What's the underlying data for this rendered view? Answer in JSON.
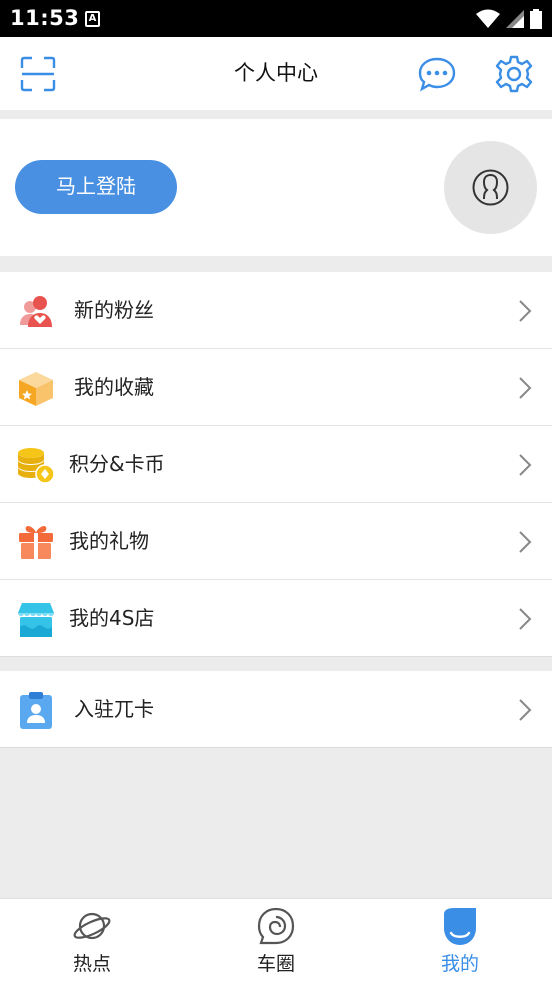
{
  "status_bar": {
    "time": "11:53",
    "notification_letter": "A"
  },
  "header": {
    "title": "个人中心",
    "scan_icon": "scan-icon",
    "message_icon": "message-icon",
    "settings_icon": "gear-icon"
  },
  "profile": {
    "login_label": "马上登陆",
    "avatar_icon": "user-avatar-icon"
  },
  "menu_group_1": [
    {
      "label": "新的粉丝",
      "icon": "fans-icon"
    },
    {
      "label": "我的收藏",
      "icon": "favorites-box-icon"
    },
    {
      "label": "积分&卡币",
      "icon": "coins-icon"
    },
    {
      "label": "我的礼物",
      "icon": "gift-icon"
    },
    {
      "label": "我的4S店",
      "icon": "store-icon"
    }
  ],
  "menu_group_2": [
    {
      "label": "入驻兀卡",
      "icon": "clipboard-icon"
    }
  ],
  "tabs": [
    {
      "label": "热点",
      "icon": "planet-icon",
      "active": false
    },
    {
      "label": "车圈",
      "icon": "circle-chat-icon",
      "active": false
    },
    {
      "label": "我的",
      "icon": "me-icon",
      "active": true
    }
  ],
  "colors": {
    "accent": "#3a8ee6",
    "login_button": "#4a90e2",
    "background": "#ececec"
  }
}
